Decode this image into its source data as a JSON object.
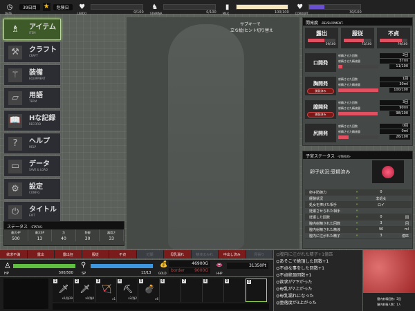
{
  "top": {
    "date_label": "DATE",
    "day": "39日目",
    "star_label": "危険日",
    "gauges": [
      {
        "label": "LIBIDO",
        "value": "0/100",
        "fill": 0,
        "color": "#555"
      },
      {
        "label": "STAMINA",
        "value": "0/100",
        "fill": 0,
        "color": "#555"
      },
      {
        "label": "MILK",
        "value": "100/100",
        "fill": 1,
        "color": "#f5e6c0"
      },
      {
        "label": "CORRUPT",
        "value": "30/100",
        "fill": 0.3,
        "color": "#6a4fd0"
      }
    ]
  },
  "menu": [
    {
      "jp": "アイテム",
      "en": "ITEM",
      "icon": "potion-icon"
    },
    {
      "jp": "クラフト",
      "en": "CRAFT",
      "icon": "hammer-icon"
    },
    {
      "jp": "装備",
      "en": "EQUIPMENT",
      "icon": "staff-icon"
    },
    {
      "jp": "用語",
      "en": "TERM",
      "icon": "document-icon"
    },
    {
      "jp": "Hな記録",
      "en": "RECORD",
      "icon": "book-icon"
    },
    {
      "jp": "ヘルプ",
      "en": "HELP",
      "icon": "question-icon"
    },
    {
      "jp": "データ",
      "en": "SAVE & LOAD",
      "icon": "folder-icon"
    },
    {
      "jp": "設定",
      "en": "CONFIG",
      "icon": "gear-icon"
    },
    {
      "jp": "タイトル",
      "en": "EXIT",
      "icon": "power-icon"
    }
  ],
  "status": {
    "title": "ステータス",
    "sub": "-STATUS-",
    "cols": [
      {
        "k": "最大HP",
        "v": "500"
      },
      {
        "k": "最大SP",
        "v": "13"
      },
      {
        "k": "力",
        "v": "40"
      },
      {
        "k": "防御",
        "v": "30"
      },
      {
        "k": "器用さ",
        "v": "33"
      }
    ]
  },
  "hint": {
    "line1": "サブキーで",
    "line2": "立ち絵/ヒント切り替え"
  },
  "development": {
    "title": "開発度",
    "sub": "-DEVELOPMENT-",
    "top": [
      {
        "k": "露出",
        "v": "59/100",
        "fill": 0.59
      },
      {
        "k": "服従",
        "v": "72/100",
        "fill": 0.72
      },
      {
        "k": "不貞",
        "v": "79/100",
        "fill": 0.79
      }
    ],
    "parts": [
      {
        "name": "口開発",
        "badge": null,
        "count_label": "射精させた回数",
        "count": "2回",
        "amount_label": "射精させた精液量",
        "amount": "57ml",
        "progress": "11/100",
        "fill": 0.11
      },
      {
        "name": "胸開発",
        "badge": "開発済み",
        "count_label": "射精させた回数",
        "count": "1回",
        "amount_label": "射精させた精液量",
        "amount": "30ml",
        "progress": "100/100",
        "fill": 1
      },
      {
        "name": "膣開発",
        "badge": "開発済み",
        "count_label": "射精させた回数",
        "count": "3回",
        "amount_label": "射精させた精液量",
        "amount": "90ml",
        "progress": "98/100",
        "fill": 0.98
      },
      {
        "name": "尻開発",
        "badge": null,
        "count_label": "射精させた回数",
        "count": "0回",
        "amount_label": "射精させた精液量",
        "amount": "0ml",
        "progress": "26/100",
        "fill": 0.26
      }
    ]
  },
  "uterus": {
    "title": "子宮ステータス",
    "sub": "-UTERUS-",
    "state": "卵子状況:受精済み",
    "rows": [
      {
        "k": "卵子防御力",
        "v": "0",
        "u": ""
      },
      {
        "k": "経験状況",
        "v": "非処女",
        "u": ""
      },
      {
        "k": "処女を捧げた相手",
        "v": "ロイ",
        "u": ""
      },
      {
        "k": "妊娠させられた相手",
        "v": "",
        "u": ""
      },
      {
        "k": "妊娠した回数",
        "v": "0",
        "u": "回"
      },
      {
        "k": "膣内射精された回数",
        "v": "3",
        "u": "回"
      },
      {
        "k": "膣内射精された精液",
        "v": "90",
        "u": "ml"
      },
      {
        "k": "膣内に注がれた精子",
        "v": "3",
        "u": "億匹"
      }
    ],
    "arrow": "»"
  },
  "tags": [
    {
      "t": "欲求不満",
      "on": true
    },
    {
      "t": "露出",
      "on": true
    },
    {
      "t": "露出狂",
      "on": true
    },
    {
      "t": "服従",
      "on": true
    },
    {
      "t": "不貞",
      "on": true
    },
    {
      "t": "妊娠",
      "on": false
    },
    {
      "t": "母乳漏れ",
      "on": true
    },
    {
      "t": "精液まみれ",
      "on": false
    },
    {
      "t": "中出し済み",
      "on": true
    },
    {
      "t": "見張り",
      "on": false
    }
  ],
  "stats": {
    "hp_label": "HP",
    "hp": "500/500",
    "hp_fill": 1,
    "sp_label": "SP",
    "sp": "13/13",
    "sp_fill": 1,
    "gold_label": "GOLD",
    "gold": "46900G",
    "border_label": "border",
    "border": "9000G",
    "hhp_label": "HHP",
    "hhp": "31350Pt"
  },
  "inventory": [
    {
      "n": "1",
      "c": "x1/残39",
      "icon": "sword-icon",
      "g": "🗡"
    },
    {
      "n": "2",
      "c": "x0/残0",
      "icon": "sword-icon",
      "g": "🗡"
    },
    {
      "n": "3",
      "c": "x1",
      "icon": "crossbow-icon",
      "g": "🏹"
    },
    {
      "n": "4",
      "c": "x2/残2",
      "icon": "shovel-icon",
      "g": "⛏"
    },
    {
      "n": "5",
      "c": "x6",
      "icon": "bomb-icon",
      "g": "💣"
    },
    {
      "n": "6",
      "c": "",
      "icon": "",
      "g": ""
    },
    {
      "n": "7",
      "c": "",
      "icon": "",
      "g": ""
    },
    {
      "n": "8",
      "c": "",
      "icon": "",
      "g": ""
    },
    {
      "n": "9",
      "c": "",
      "icon": "",
      "g": ""
    },
    {
      "n": "0",
      "c": "",
      "icon": "",
      "g": ""
    }
  ],
  "log": [
    "膣内に注がれた精子+1億匹",
    "あそこで絶頂した回数+1",
    "不貞な事をした回数+1",
    "不貞絶頂回数+1",
    "欲求が7下がった",
    "母乳が7上がった",
    "母乳漏れになった",
    "堕落度が3上がった"
  ],
  "cutin": {
    "line1": "膣内射精回数：2回",
    "line2": "膣内射精人数：1人"
  }
}
